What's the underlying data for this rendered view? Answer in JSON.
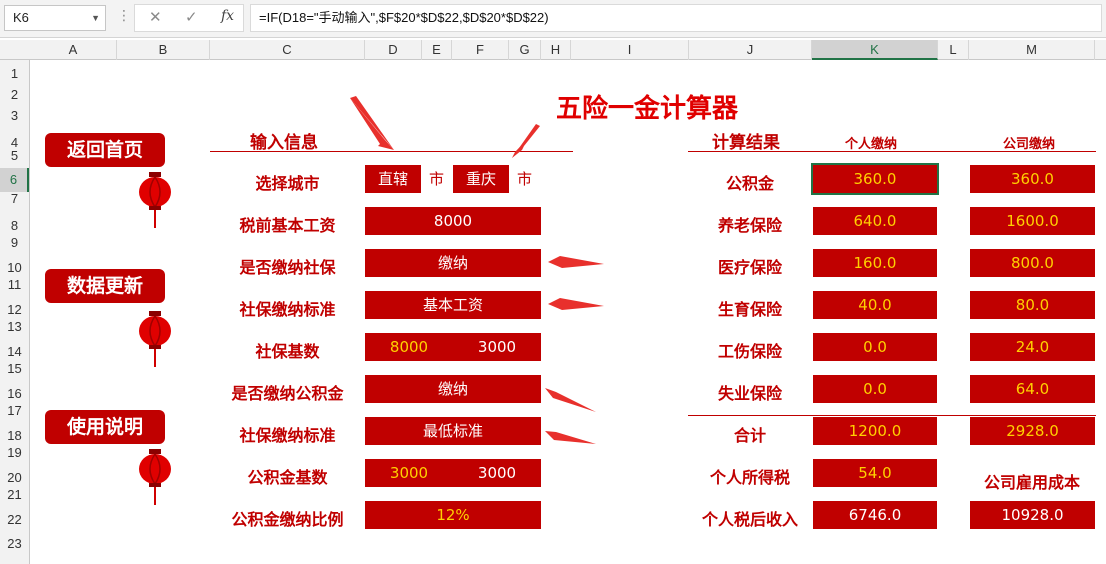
{
  "formula_bar": {
    "name_box": "K6",
    "fx_label": "fx",
    "formula": "=IF(D18=\"手动输入\",$F$20*$D$22,$D$20*$D$22)"
  },
  "columns": [
    "A",
    "B",
    "C",
    "D",
    "E",
    "F",
    "G",
    "H",
    "I",
    "J",
    "K",
    "L",
    "M"
  ],
  "rows": [
    "1",
    "2",
    "3",
    "4",
    "5",
    "6",
    "7",
    "8",
    "9",
    "10",
    "11",
    "12",
    "13",
    "14",
    "15",
    "16",
    "17",
    "18",
    "19",
    "20",
    "21",
    "22",
    "23"
  ],
  "nav": {
    "home": "返回首页",
    "update": "数据更新",
    "help": "使用说明"
  },
  "title": "五险一金计算器",
  "input_section": {
    "title": "输入信息",
    "city_label": "选择城市",
    "city_btn1": "直辖",
    "city_suffix1": "市",
    "city_btn2": "重庆",
    "city_suffix2": "市",
    "salary_label": "税前基本工资",
    "salary_value": "8000",
    "social_pay_label": "是否缴纳社保",
    "social_pay_value": "缴纳",
    "social_std_label": "社保缴纳标准",
    "social_std_value": "基本工资",
    "social_base_label": "社保基数",
    "social_base_v1": "8000",
    "social_base_v2": "3000",
    "fund_pay_label": "是否缴纳公积金",
    "fund_pay_value": "缴纳",
    "fund_std_label": "社保缴纳标准",
    "fund_std_value": "最低标准",
    "fund_base_label": "公积金基数",
    "fund_base_v1": "3000",
    "fund_base_v2": "3000",
    "fund_ratio_label": "公积金缴纳比例",
    "fund_ratio_value": "12%"
  },
  "result_section": {
    "title": "计算结果",
    "personal_header": "个人缴纳",
    "company_header": "公司缴纳",
    "rows": [
      {
        "label": "公积金",
        "personal": "360.0",
        "company": "360.0"
      },
      {
        "label": "养老保险",
        "personal": "640.0",
        "company": "1600.0"
      },
      {
        "label": "医疗保险",
        "personal": "160.0",
        "company": "800.0"
      },
      {
        "label": "生育保险",
        "personal": "40.0",
        "company": "80.0"
      },
      {
        "label": "工伤保险",
        "personal": "0.0",
        "company": "24.0"
      },
      {
        "label": "失业保险",
        "personal": "0.0",
        "company": "64.0"
      }
    ],
    "total_label": "合计",
    "total_personal": "1200.0",
    "total_company": "2928.0",
    "tax_label": "个人所得税",
    "tax_value": "54.0",
    "employ_cost_label": "公司雇用成本",
    "after_tax_label": "个人税后收入",
    "after_tax_value": "6746.0",
    "employ_cost_value": "10928.0"
  },
  "colors": {
    "accent": "#c00000",
    "value_yellow": "#ffd000",
    "title_red": "#e00000",
    "excel_green": "#217346"
  }
}
